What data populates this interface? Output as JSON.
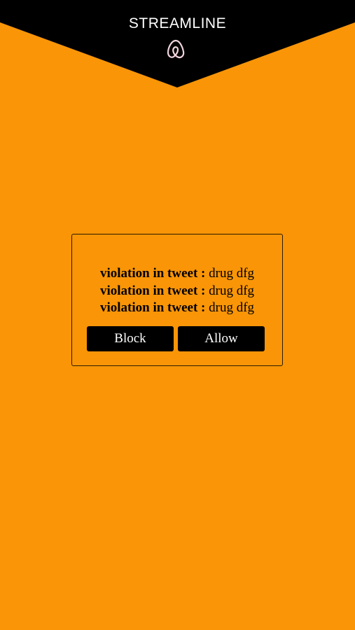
{
  "app": {
    "title": "STREAMLINE",
    "logo_icon": "airbnb-style-loop-icon"
  },
  "colors": {
    "background": "#F99507",
    "header": "#000000",
    "button": "#000000",
    "button_text": "#FFFFFF"
  },
  "dialog": {
    "violations": [
      {
        "label": "violation in tweet :",
        "value": "drug dfg"
      },
      {
        "label": "violation in tweet :",
        "value": "drug dfg"
      },
      {
        "label": "violation in tweet :",
        "value": "drug dfg"
      }
    ],
    "block_label": "Block",
    "allow_label": "Allow"
  }
}
